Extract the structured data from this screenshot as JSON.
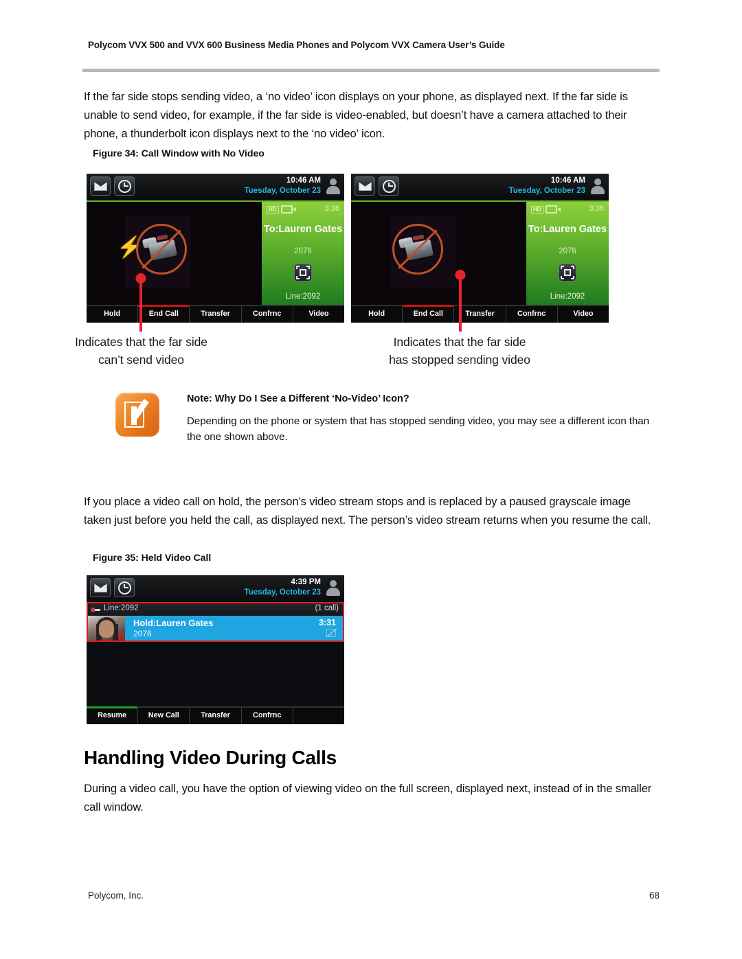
{
  "header": {
    "title": "Polycom VVX 500 and VVX 600 Business Media Phones and Polycom VVX Camera User’s Guide"
  },
  "footer": {
    "company": "Polycom, Inc.",
    "page_number": "68"
  },
  "paragraphs": {
    "p1": "If the far side stops sending video, a ‘no video’ icon displays on your phone, as displayed next. If the far side is unable to send video, for example, if the far side is video-enabled, but doesn’t have a camera attached to their phone, a thunderbolt icon displays next to the ‘no video’ icon.",
    "p2": "If you place a video call on hold, the person’s video stream stops and is replaced by a paused grayscale image taken just before you held the call, as displayed next. The person’s video stream returns when you resume the call.",
    "p3": "During a video call, you have the option of viewing video on the full screen, displayed next, instead of in the smaller call window."
  },
  "figure34": {
    "caption": "Figure 34: Call Window with No Video",
    "left_callout": "Indicates that the far side\ncan’t send video",
    "right_callout": "Indicates that the far side\nhas stopped sending video",
    "phone": {
      "status": {
        "time": "10:46 AM",
        "date": "Tuesday, October 23",
        "mail_icon": "envelope-icon",
        "clock_icon": "clock-icon",
        "avatar_icon": "user-avatar-icon"
      },
      "call": {
        "hd_badge": "HD",
        "video_icon": "video-camera-icon",
        "duration": "3:36",
        "party": "To:Lauren Gates",
        "extension": "2076",
        "fullscreen_icon": "fullscreen-icon",
        "line": "Line:2092",
        "novideo_icon": "no-video-camera-icon",
        "thunderbolt_icon": "thunderbolt-icon"
      },
      "softkeys": [
        "Hold",
        "End Call",
        "Transfer",
        "Confrnc",
        "Video"
      ]
    }
  },
  "note": {
    "title": "Note: Why Do I See a Different ‘No-Video’ Icon?",
    "body": "Depending on the phone or system that has stopped sending video, you may see a different icon than the one shown above.",
    "icon": "note-pencil-icon",
    "icon_color": "#ef8b2c"
  },
  "figure35": {
    "caption": "Figure 35: Held Video Call",
    "phone": {
      "status": {
        "time": "4:39 PM",
        "date": "Tuesday, October 23",
        "mail_icon": "envelope-icon",
        "clock_icon": "clock-icon",
        "avatar_icon": "user-avatar-icon"
      },
      "line_header": {
        "line": "Line:2092",
        "call_count": "(1 call)",
        "line_key_icon": "line-key-icon"
      },
      "call_row": {
        "name": "Hold:Lauren Gates",
        "extension": "2076",
        "duration": "3:31",
        "thumbnail_icon": "contact-video-thumbnail",
        "hold_icon": "pause-icon",
        "novideo_icon": "no-video-icon"
      },
      "softkeys": [
        "Resume",
        "New Call",
        "Transfer",
        "Confrnc",
        ""
      ]
    }
  },
  "section": {
    "heading": "Handling Video During Calls"
  },
  "colors": {
    "accent_green": "#6bb32a",
    "accent_blue": "#27b7e0",
    "callout_red": "#e8232b",
    "note_orange": "#ef8b2c",
    "selection_blue": "#1fa6e0"
  }
}
